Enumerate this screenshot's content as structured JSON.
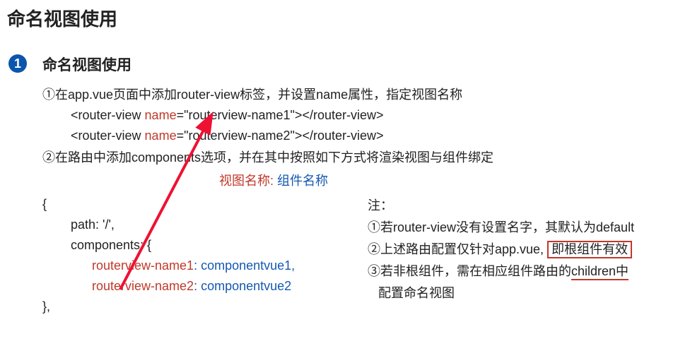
{
  "page_title": "命名视图使用",
  "section": {
    "number": "1",
    "title": "命名视图使用",
    "step1_intro": "①在app.vue页面中添加router-view标签，并设置name属性，指定视图名称",
    "rv1": {
      "open": "<router-view ",
      "attr": "name",
      "eq_val": "=\"routerview-name1\">",
      "close": "</router-view>"
    },
    "rv2": {
      "open": "<router-view ",
      "attr": "name",
      "eq_val": "=\"routerview-name2\">",
      "close": "</router-view>"
    },
    "step2_intro": "②在路由中添加components选项，并在其中按照如下方式将渲染视图与组件绑定",
    "hint": {
      "view_name": "视图名称:",
      "comp_name": " 组件名称"
    },
    "code": {
      "l1": "{",
      "l2": "path: '/',",
      "l3": "components: {",
      "k1": "routerview-name1",
      "v1": ": componentvue1,",
      "k2": "routerview-name2",
      "v2": ": componentvue2",
      "l4": "},"
    },
    "notes": {
      "title": "注：",
      "n1": "①若router-view没有设置名字，其默认为default",
      "n2_pre": "②上述路由配置仅针对app.vue,",
      "n2_box": "即根组件有效",
      "n3_pre": "③若非根组件，需在相应组件路由的",
      "n3_underline": "children中",
      "n4": "   配置命名视图"
    }
  }
}
